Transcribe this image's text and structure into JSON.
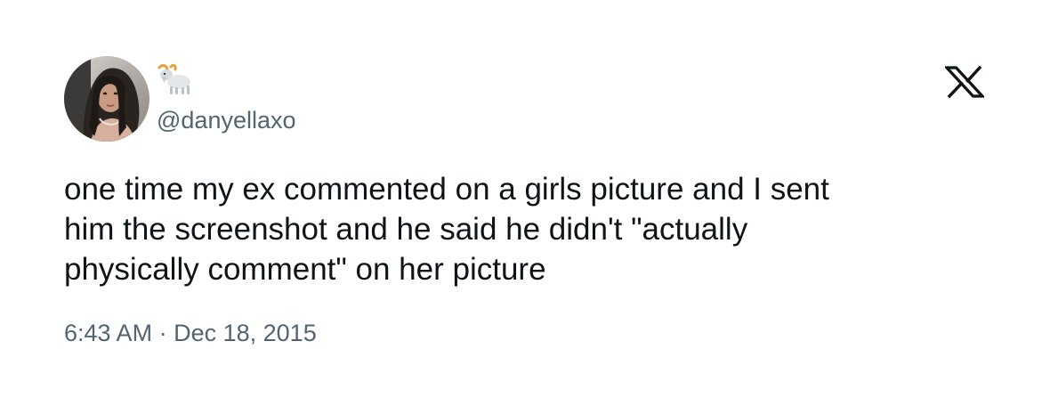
{
  "author": {
    "handle": "@danyellaxo",
    "name_emoji_icon": "goat-icon",
    "avatar_icon": "profile-photo"
  },
  "brand": {
    "logo_icon": "x-logo-icon",
    "logo_color": "#0f1419"
  },
  "tweet": {
    "text": "one time my ex commented on a girls picture and I sent\nhim the screenshot and he said he didn't \"actually\nphysically comment\" on her picture",
    "time": "6:43 AM",
    "separator": "·",
    "date": "Dec 18, 2015"
  },
  "colors": {
    "text_primary": "#0f1419",
    "text_secondary": "#536471",
    "background": "#ffffff"
  }
}
